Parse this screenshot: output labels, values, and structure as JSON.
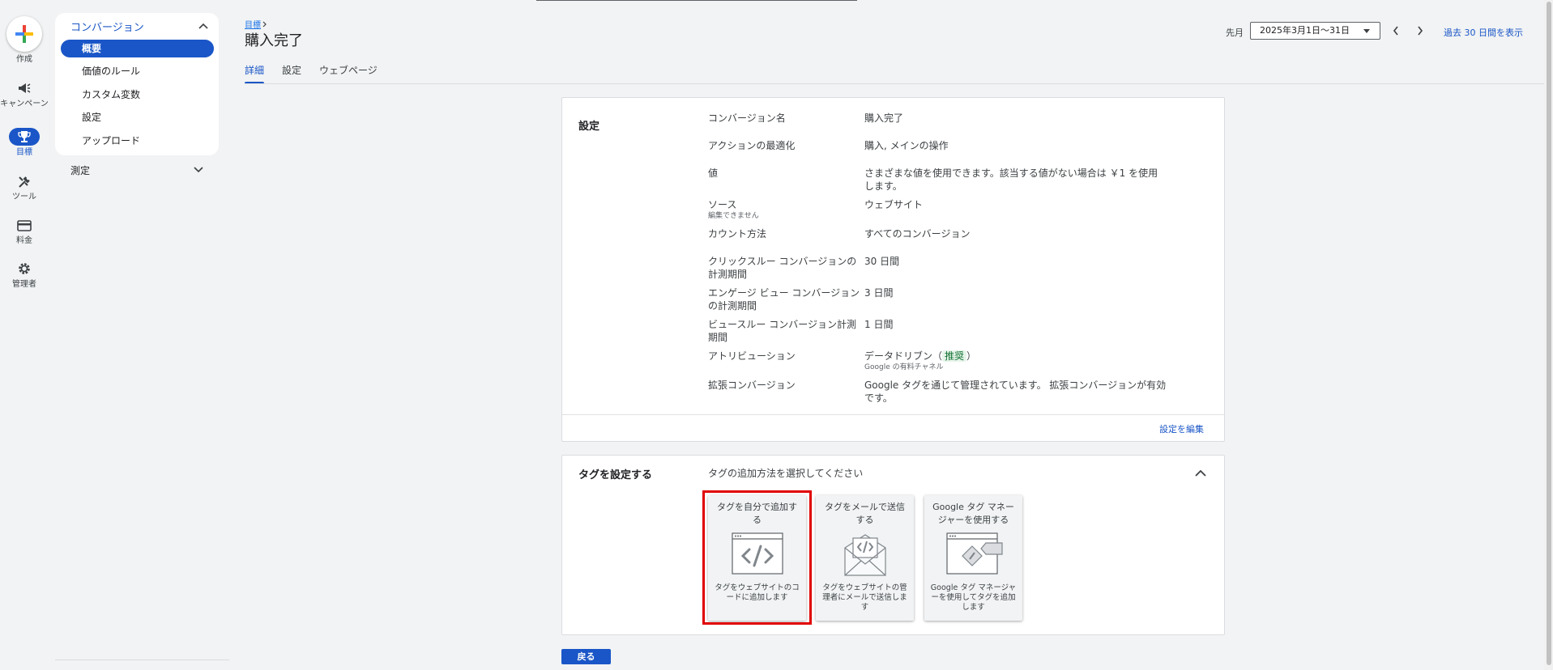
{
  "rail": {
    "create": "作成",
    "campaigns": "キャンペーン",
    "goals": "目標",
    "tools": "ツール",
    "billing": "料金",
    "admin": "管理者"
  },
  "nav": {
    "section": "コンバージョン",
    "items": [
      "概要",
      "価値のルール",
      "カスタム変数",
      "設定",
      "アップロード"
    ],
    "measure": "測定"
  },
  "header": {
    "breadcrumb": "目標",
    "title": "購入完了",
    "tabs": [
      "詳細",
      "設定",
      "ウェブページ"
    ],
    "date_prefix": "先月",
    "date_range": "2025年3月1日～31日",
    "past_link": "過去 30 日間を表示"
  },
  "settings": {
    "title": "設定",
    "rows": [
      {
        "label": "コンバージョン名",
        "value": "購入完了"
      },
      {
        "label": "アクションの最適化",
        "value": "購入, メインの操作"
      },
      {
        "label": "値",
        "value": "さまざまな値を使用できます。該当する値がない場合は ￥1 を使用します。"
      },
      {
        "label": "ソース",
        "sub": "編集できません",
        "value": "ウェブサイト"
      },
      {
        "label": "カウント方法",
        "value": "すべてのコンバージョン"
      },
      {
        "label": "クリックスルー コンバージョンの計測期間",
        "value": "30 日間"
      },
      {
        "label": "エンゲージ ビュー コンバージョンの計測期間",
        "value": "3 日間"
      },
      {
        "label": "ビュースルー コンバージョン計測期間",
        "value": "1 日間"
      },
      {
        "label": "アトリビューション",
        "value_prefix": "データドリブン（",
        "badge": "推奨",
        "value_suffix": "）",
        "value_sub": "Google の有料チャネル"
      },
      {
        "label": "拡張コンバージョン",
        "value": "Google タグを通じて管理されています。 拡張コンバージョンが有効です。"
      }
    ],
    "edit_link": "設定を編集"
  },
  "tag": {
    "title": "タグを設定する",
    "instruction": "タグの追加方法を選択してください",
    "options": [
      {
        "title": "タグを自分で追加する",
        "desc": "タグをウェブサイトのコードに追加します",
        "icon": "code-window-icon"
      },
      {
        "title": "タグをメールで送信する",
        "desc": "タグをウェブサイトの管理者にメールで送信します",
        "icon": "email-code-icon"
      },
      {
        "title": "Google タグ マネージャーを使用する",
        "desc": "Google タグ マネージャーを使用してタグを追加します",
        "icon": "tag-manager-icon"
      }
    ]
  },
  "back_button": "戻る",
  "colors": {
    "accent": "#1a56c7",
    "highlight": "#e00000",
    "badge_bg": "#e6f4ea",
    "badge_text": "#137333"
  }
}
